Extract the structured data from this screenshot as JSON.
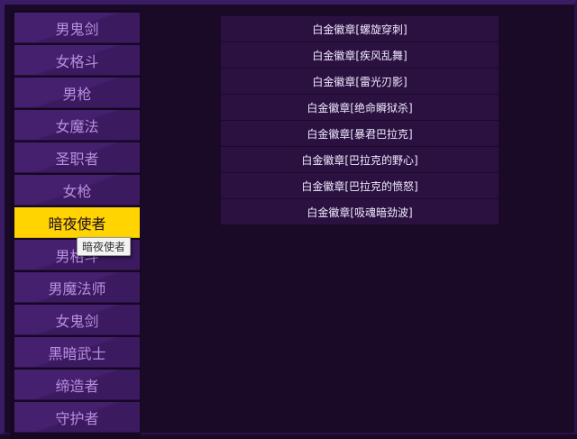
{
  "sidebar": {
    "items": [
      {
        "label": "男鬼剑"
      },
      {
        "label": "女格斗"
      },
      {
        "label": "男枪"
      },
      {
        "label": "女魔法"
      },
      {
        "label": "圣职者"
      },
      {
        "label": "女枪"
      },
      {
        "label": "暗夜使者"
      },
      {
        "label": "男格斗"
      },
      {
        "label": "男魔法师"
      },
      {
        "label": "女鬼剑"
      },
      {
        "label": "黑暗武士"
      },
      {
        "label": "缔造者"
      },
      {
        "label": "守护者"
      }
    ],
    "active_index": 6,
    "active_color": "#ffd400"
  },
  "tooltip": {
    "text": "暗夜使者"
  },
  "badges": [
    {
      "label": "白金徽章[螺旋穿刺]"
    },
    {
      "label": "白金徽章[疾风乱舞]"
    },
    {
      "label": "白金徽章[雷光刃影]"
    },
    {
      "label": "白金徽章[绝命瞬狱杀]"
    },
    {
      "label": "白金徽章[暴君巴拉克]"
    },
    {
      "label": "白金徽章[巴拉克的野心]"
    },
    {
      "label": "白金徽章[巴拉克的愤怒]"
    },
    {
      "label": "白金徽章[吸魂暗劲波]"
    }
  ],
  "colors": {
    "background": "#1a0a28",
    "item": "#45206e",
    "item_text": "#b88fe0",
    "row": "#2a1140"
  }
}
